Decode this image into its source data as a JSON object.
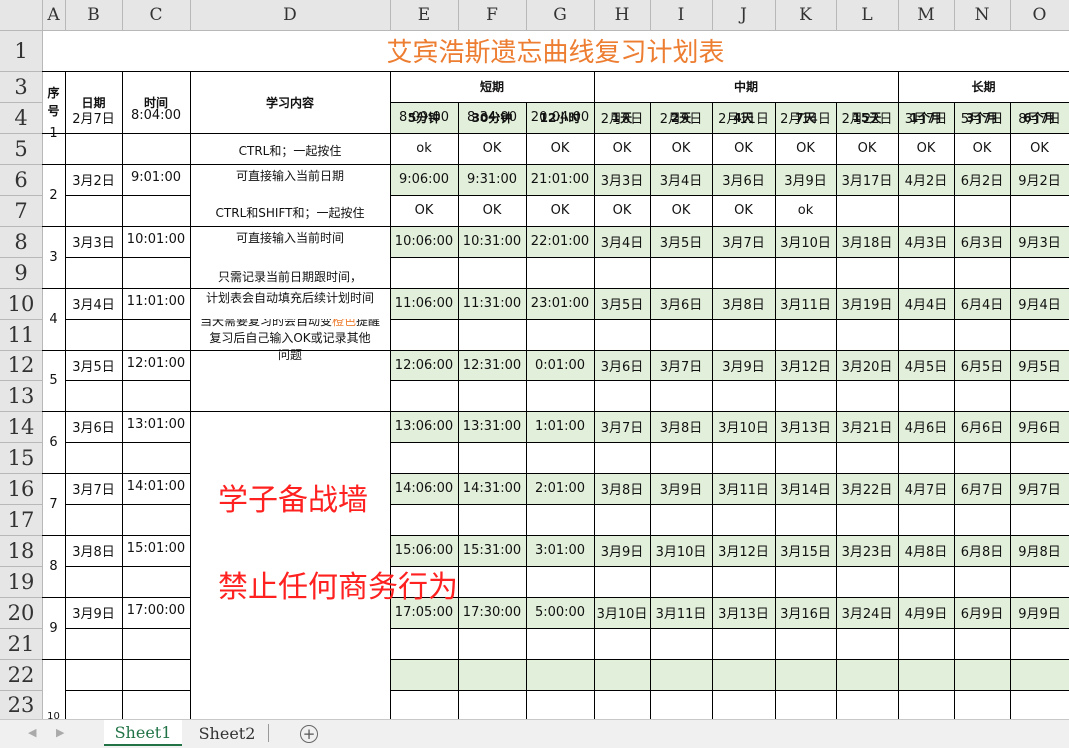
{
  "columns": [
    "A",
    "B",
    "C",
    "D",
    "E",
    "F",
    "G",
    "H",
    "I",
    "J",
    "K",
    "L",
    "M",
    "N",
    "O"
  ],
  "rows": [
    "1",
    "3",
    "4",
    "5",
    "6",
    "7",
    "8",
    "9",
    "10",
    "11",
    "12",
    "13",
    "14",
    "15",
    "16",
    "17",
    "18",
    "19",
    "20",
    "21",
    "22",
    "23",
    "10"
  ],
  "title": "艾宾浩斯遗忘曲线复习计划表",
  "headers": {
    "seq": "序号",
    "date": "日期",
    "time": "时间",
    "content": "学习内容",
    "short": "短期",
    "mid": "中期",
    "long": "长期",
    "intervals": [
      "5分钟",
      "30分钟",
      "12小时",
      "1天",
      "2天",
      "4天",
      "7天",
      "15天",
      "1个月",
      "3个月",
      "6个月"
    ]
  },
  "records": [
    {
      "no": "1",
      "date": "2月7日",
      "time": "8:04:00",
      "schedule": [
        "8:09:00",
        "8:34:00",
        "20:04:00",
        "2月8日",
        "2月9日",
        "2月11日",
        "2月14日",
        "2月22日",
        "3月7日",
        "5月7日",
        "8月7日"
      ],
      "status": [
        "ok",
        "OK",
        "OK",
        "OK",
        "OK",
        "OK",
        "OK",
        "OK",
        "OK",
        "OK",
        "OK"
      ]
    },
    {
      "no": "2",
      "date": "3月2日",
      "time": "9:01:00",
      "schedule": [
        "9:06:00",
        "9:31:00",
        "21:01:00",
        "3月3日",
        "3月4日",
        "3月6日",
        "3月9日",
        "3月17日",
        "4月2日",
        "6月2日",
        "9月2日"
      ],
      "status": [
        "OK",
        "OK",
        "OK",
        "OK",
        "OK",
        "OK",
        "ok",
        "",
        "",
        "",
        ""
      ]
    },
    {
      "no": "3",
      "date": "3月3日",
      "time": "10:01:00",
      "schedule": [
        "10:06:00",
        "10:31:00",
        "22:01:00",
        "3月4日",
        "3月5日",
        "3月7日",
        "3月10日",
        "3月18日",
        "4月3日",
        "6月3日",
        "9月3日"
      ],
      "status": [
        "",
        "",
        "",
        "",
        "",
        "",
        "",
        "",
        "",
        "",
        ""
      ]
    },
    {
      "no": "4",
      "date": "3月4日",
      "time": "11:01:00",
      "schedule": [
        "11:06:00",
        "11:31:00",
        "23:01:00",
        "3月5日",
        "3月6日",
        "3月8日",
        "3月11日",
        "3月19日",
        "4月4日",
        "6月4日",
        "9月4日"
      ],
      "status": [
        "",
        "",
        "",
        "",
        "",
        "",
        "",
        "",
        "",
        "",
        ""
      ]
    },
    {
      "no": "5",
      "date": "3月5日",
      "time": "12:01:00",
      "schedule": [
        "12:06:00",
        "12:31:00",
        "0:01:00",
        "3月6日",
        "3月7日",
        "3月9日",
        "3月12日",
        "3月20日",
        "4月5日",
        "6月5日",
        "9月5日"
      ],
      "status": [
        "",
        "",
        "",
        "",
        "",
        "",
        "",
        "",
        "",
        "",
        ""
      ]
    },
    {
      "no": "6",
      "date": "3月6日",
      "time": "13:01:00",
      "schedule": [
        "13:06:00",
        "13:31:00",
        "1:01:00",
        "3月7日",
        "3月8日",
        "3月10日",
        "3月13日",
        "3月21日",
        "4月6日",
        "6月6日",
        "9月6日"
      ],
      "status": [
        "",
        "",
        "",
        "",
        "",
        "",
        "",
        "",
        "",
        "",
        ""
      ]
    },
    {
      "no": "7",
      "date": "3月7日",
      "time": "14:01:00",
      "schedule": [
        "14:06:00",
        "14:31:00",
        "2:01:00",
        "3月8日",
        "3月9日",
        "3月11日",
        "3月14日",
        "3月22日",
        "4月7日",
        "6月7日",
        "9月7日"
      ],
      "status": [
        "",
        "",
        "",
        "",
        "",
        "",
        "",
        "",
        "",
        "",
        ""
      ]
    },
    {
      "no": "8",
      "date": "3月8日",
      "time": "15:01:00",
      "schedule": [
        "15:06:00",
        "15:31:00",
        "3:01:00",
        "3月9日",
        "3月10日",
        "3月12日",
        "3月15日",
        "3月23日",
        "4月8日",
        "6月8日",
        "9月8日"
      ],
      "status": [
        "",
        "",
        "",
        "",
        "",
        "",
        "",
        "",
        "",
        "",
        ""
      ]
    },
    {
      "no": "9",
      "date": "3月9日",
      "time": "17:00:00",
      "schedule": [
        "17:05:00",
        "17:30:00",
        "5:00:00",
        "3月10日",
        "3月11日",
        "3月13日",
        "3月16日",
        "3月24日",
        "4月9日",
        "6月9日",
        "9月9日"
      ],
      "status": [
        "",
        "",
        "",
        "",
        "",
        "",
        "",
        "",
        "",
        "",
        ""
      ]
    }
  ],
  "row23_no": "10",
  "content_notes": {
    "r1_a": "CTRL和；一起按住",
    "r1_b": "可直接输入当前日期",
    "r2_a": "CTRL和SHIFT和；一起按住",
    "r2_b": "可直接输入当前时间",
    "r3_a": "只需记录当前日期跟时间，",
    "r3_b": "计划表会自动填充后续计划时间",
    "r4_a_pre": "当天需要复习的会自动变",
    "r4_a_hl": "橙色",
    "r4_a_post": "提醒",
    "r4_b": "复习后自己输入OK或记录其他问题"
  },
  "watermark": [
    "学子备战墙",
    "禁止任何商务行为"
  ],
  "highlight_color": "#ffc000",
  "schedule_fill_color": "#e2efda",
  "title_color": "#ed7d31",
  "sheets": [
    "Sheet1",
    "Sheet2"
  ],
  "active_sheet": "Sheet1",
  "add_sheet_icon": "plus-circle-icon"
}
